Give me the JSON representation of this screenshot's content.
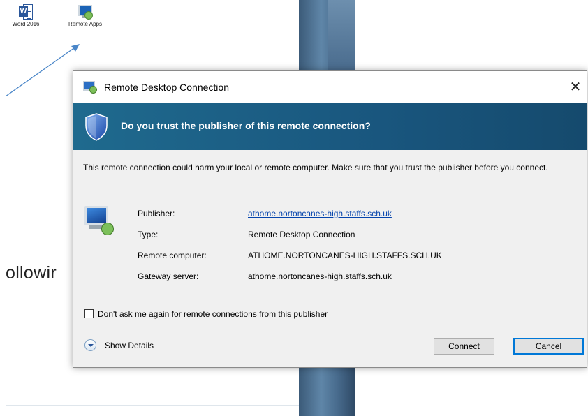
{
  "desktop": {
    "icons": [
      {
        "label": "Word 2016",
        "icon": "word-icon"
      },
      {
        "label": "Remote Apps",
        "icon": "remote-apps-icon"
      }
    ],
    "partial_text": "ollowir",
    "bottom_fragment": " "
  },
  "dialog": {
    "title": "Remote Desktop Connection",
    "close_glyph": "✕",
    "banner": "Do you trust the publisher of this remote connection?",
    "warning": "This remote connection could harm your local or remote computer. Make sure that you trust the publisher before you connect.",
    "fields": [
      {
        "label": "Publisher:",
        "value": "athome.nortoncanes-high.staffs.sch.uk",
        "is_link": true
      },
      {
        "label": "Type:",
        "value": "Remote Desktop Connection"
      },
      {
        "label": "Remote computer:",
        "value": "ATHOME.NORTONCANES-HIGH.STAFFS.SCH.UK"
      },
      {
        "label": "Gateway server:",
        "value": "athome.nortoncanes-high.staffs.sch.uk"
      }
    ],
    "checkbox": {
      "label": "Don't ask me again for remote connections from this publisher",
      "checked": false
    },
    "show_details": "Show Details",
    "buttons": {
      "connect": "Connect",
      "cancel": "Cancel"
    }
  },
  "colors": {
    "banner": "#19567e",
    "link": "#0645ad",
    "focus": "#0078d7"
  }
}
